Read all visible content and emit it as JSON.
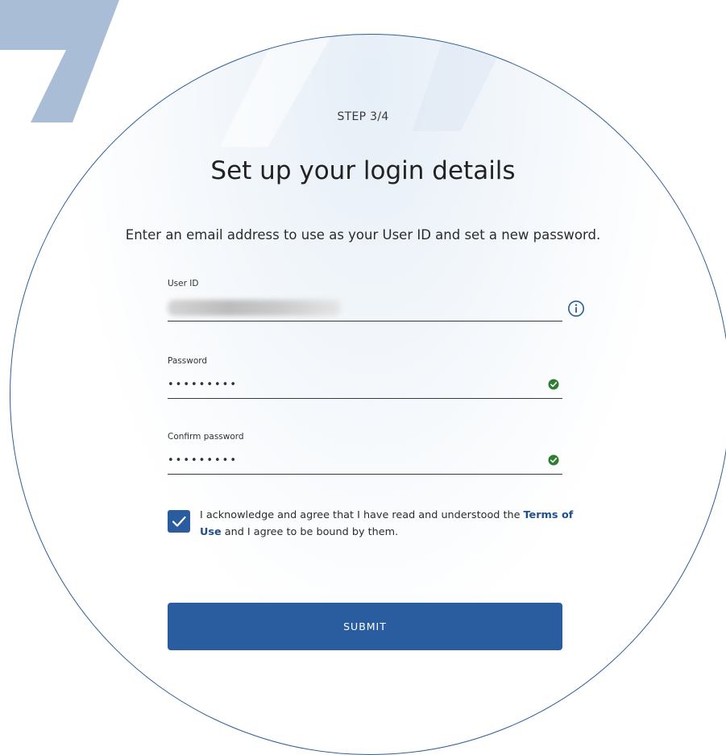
{
  "step": {
    "label": "STEP 3/4"
  },
  "header": {
    "title": "Set up your login details",
    "subtitle": "Enter an email address to use as your User ID and set a new password."
  },
  "form": {
    "user_id": {
      "label": "User ID",
      "value_obscured": true,
      "help_icon": "info-icon"
    },
    "password": {
      "label": "Password",
      "value": "•••••••••",
      "status_icon": "check-circle-icon",
      "status_color": "#2e7d32"
    },
    "confirm_password": {
      "label": "Confirm password",
      "value": "•••••••••",
      "status_icon": "check-circle-icon",
      "status_color": "#2e7d32"
    },
    "consent": {
      "checked": true,
      "text_before": "I acknowledge and agree that I have read and understood the ",
      "link_text": "Terms of Use",
      "text_after": " and I agree to be bound by them."
    },
    "submit_label": "SUBMIT"
  },
  "colors": {
    "primary": "#2a5d9f",
    "outline": "#2e5e97",
    "decoration": "#a9bdd6",
    "success": "#2e7d32"
  }
}
